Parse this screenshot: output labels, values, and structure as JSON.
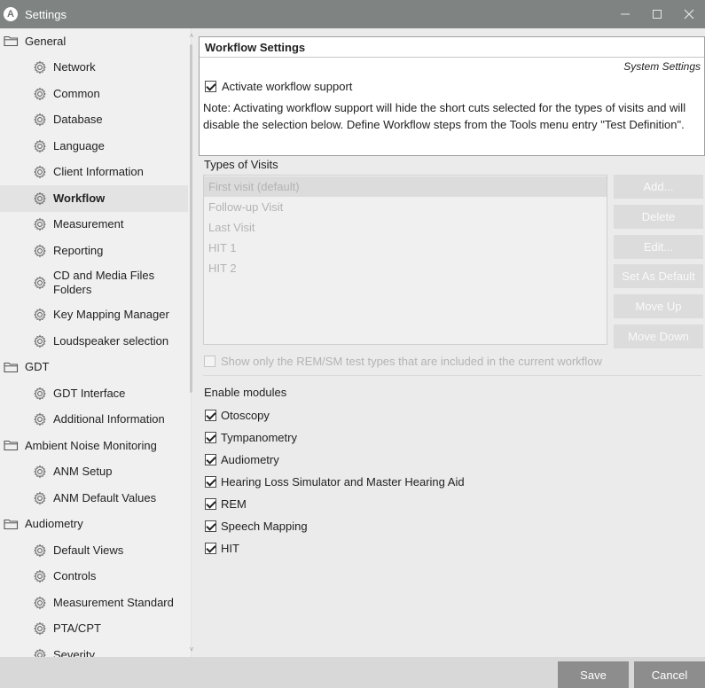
{
  "window": {
    "title": "Settings",
    "logo_letter": "A"
  },
  "sidebar": {
    "items": [
      {
        "label": "General",
        "type": "category"
      },
      {
        "label": "Network",
        "type": "sub"
      },
      {
        "label": "Common",
        "type": "sub"
      },
      {
        "label": "Database",
        "type": "sub"
      },
      {
        "label": "Language",
        "type": "sub"
      },
      {
        "label": "Client Information",
        "type": "sub"
      },
      {
        "label": "Workflow",
        "type": "sub",
        "selected": true
      },
      {
        "label": "Measurement",
        "type": "sub"
      },
      {
        "label": "Reporting",
        "type": "sub"
      },
      {
        "label": "CD and Media Files Folders",
        "type": "sub"
      },
      {
        "label": "Key Mapping Manager",
        "type": "sub"
      },
      {
        "label": "Loudspeaker selection",
        "type": "sub"
      },
      {
        "label": "GDT",
        "type": "category"
      },
      {
        "label": "GDT Interface",
        "type": "sub"
      },
      {
        "label": "Additional Information",
        "type": "sub"
      },
      {
        "label": "Ambient Noise Monitoring",
        "type": "category"
      },
      {
        "label": "ANM Setup",
        "type": "sub"
      },
      {
        "label": "ANM Default Values",
        "type": "sub"
      },
      {
        "label": "Audiometry",
        "type": "category"
      },
      {
        "label": "Default Views",
        "type": "sub"
      },
      {
        "label": "Controls",
        "type": "sub"
      },
      {
        "label": "Measurement Standard",
        "type": "sub"
      },
      {
        "label": "PTA/CPT",
        "type": "sub"
      },
      {
        "label": "Severity",
        "type": "sub"
      }
    ]
  },
  "workflow": {
    "title": "Workflow Settings",
    "system_settings": "System Settings",
    "activate_label": "Activate workflow support",
    "activate_checked": true,
    "note": "Note: Activating workflow support will hide the short cuts selected for the types of visits and will disable the selection below. Define Workflow steps from the Tools menu entry \"Test Definition\"."
  },
  "visits": {
    "label": "Types of Visits",
    "items": [
      "First visit (default)",
      "Follow-up Visit",
      "Last Visit",
      "HIT 1",
      "HIT 2"
    ],
    "buttons": [
      "Add...",
      "Delete",
      "Edit...",
      "Set As Default",
      "Move Up",
      "Move Down"
    ]
  },
  "rem_option": {
    "label": "Show only the REM/SM test types that are included in the current workflow",
    "checked": false
  },
  "modules": {
    "label": "Enable modules",
    "items": [
      {
        "label": "Otoscopy",
        "checked": true
      },
      {
        "label": "Tympanometry",
        "checked": true
      },
      {
        "label": "Audiometry",
        "checked": true
      },
      {
        "label": "Hearing Loss Simulator and Master Hearing Aid",
        "checked": true
      },
      {
        "label": "REM",
        "checked": true
      },
      {
        "label": "Speech Mapping",
        "checked": true
      },
      {
        "label": "HIT",
        "checked": true
      }
    ]
  },
  "footer": {
    "save_label": "Save",
    "cancel_label": "Cancel"
  },
  "colors": {
    "titlebar": "#7f8482",
    "footer_button": "#8d8d8d",
    "disabled_text": "#b3b3b3"
  }
}
